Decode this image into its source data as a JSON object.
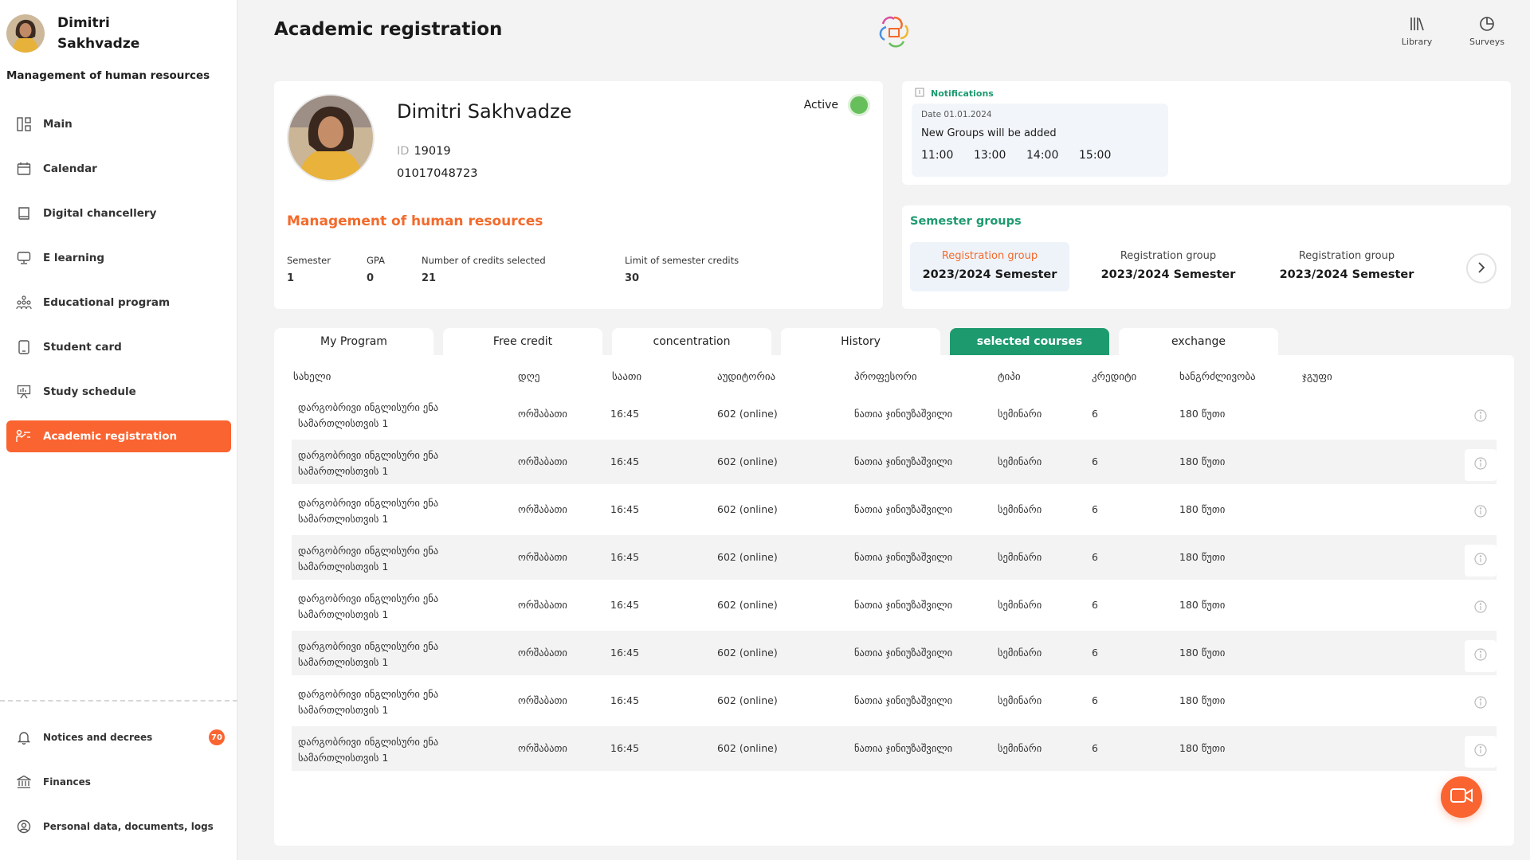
{
  "user": {
    "name": "Dimitri Sakhvadze",
    "department": "Management of human resources"
  },
  "sidebar": {
    "items": [
      {
        "label": "Main",
        "icon": "dashboard-icon"
      },
      {
        "label": "Calendar",
        "icon": "calendar-icon"
      },
      {
        "label": "Digital chancellery",
        "icon": "book-icon"
      },
      {
        "label": "E learning",
        "icon": "monitor-icon"
      },
      {
        "label": "Educational program",
        "icon": "people-icon"
      },
      {
        "label": "Student card",
        "icon": "phone-card-icon"
      },
      {
        "label": "Study schedule",
        "icon": "presentation-icon"
      },
      {
        "label": "Academic registration",
        "icon": "registration-icon",
        "active": true
      }
    ],
    "bottom_items": [
      {
        "label": "Notices and decrees",
        "icon": "bell-icon",
        "badge": "70"
      },
      {
        "label": "Finances",
        "icon": "bank-icon"
      },
      {
        "label": "Personal data, documents, logs",
        "icon": "user-circle-icon"
      }
    ]
  },
  "header": {
    "title": "Academic registration",
    "actions": [
      {
        "label": "Library",
        "icon": "library-icon"
      },
      {
        "label": "Surveys",
        "icon": "pie-chart-icon"
      }
    ]
  },
  "profile": {
    "name": "Dimitri Sakhvadze",
    "id_label": "ID",
    "id": "19019",
    "personal_number": "01017048723",
    "status": "Active",
    "program": "Management of human resources",
    "stats": [
      {
        "label": "Semester",
        "value": "1"
      },
      {
        "label": "GPA",
        "value": "0"
      },
      {
        "label": "Number of credits selected",
        "value": "21"
      },
      {
        "label": "Limit of semester credits",
        "value": "30"
      }
    ]
  },
  "notifications": {
    "title": "Notifications",
    "date": "Date 01.01.2024",
    "text": "New Groups will be added",
    "times": [
      "11:00",
      "13:00",
      "14:00",
      "15:00"
    ]
  },
  "groups": {
    "title": "Semester groups",
    "items": [
      {
        "label": "Registration group",
        "semester": "2023/2024 Semester"
      },
      {
        "label": "Registration group",
        "semester": "2023/2024 Semester"
      },
      {
        "label": "Registration group",
        "semester": "2023/2024 Semester"
      }
    ]
  },
  "tabs": [
    "My Program",
    "Free credit",
    "concentration",
    "History",
    "selected courses",
    "exchange"
  ],
  "active_tab": "selected courses",
  "table": {
    "headers": [
      "სახელი",
      "დღე",
      "საათი",
      "აუდიტორია",
      "პროფესორი",
      "ტიპი",
      "კრედიტი",
      "ხანგრძლივობა",
      "ჯგუფი"
    ],
    "rows": [
      {
        "name1": "დარგობრივი ინგლისური ენა",
        "name2": "სამართლისთვის 1",
        "day": "ორშაბათი",
        "time": "16:45",
        "room": "602 (online)",
        "professor": "ნათია ჯინიუზაშვილი",
        "type": "სემინარი",
        "credit": "6",
        "duration": "180 წუთი",
        "group": ""
      },
      {
        "name1": "დარგობრივი ინგლისური ენა",
        "name2": "სამართლისთვის 1",
        "day": "ორშაბათი",
        "time": "16:45",
        "room": "602 (online)",
        "professor": "ნათია ჯინიუზაშვილი",
        "type": "სემინარი",
        "credit": "6",
        "duration": "180 წუთი",
        "group": ""
      },
      {
        "name1": "დარგობრივი ინგლისური ენა",
        "name2": "სამართლისთვის 1",
        "day": "ორშაბათი",
        "time": "16:45",
        "room": "602 (online)",
        "professor": "ნათია ჯინიუზაშვილი",
        "type": "სემინარი",
        "credit": "6",
        "duration": "180 წუთი",
        "group": ""
      },
      {
        "name1": "დარგობრივი ინგლისური ენა",
        "name2": "სამართლისთვის 1",
        "day": "ორშაბათი",
        "time": "16:45",
        "room": "602 (online)",
        "professor": "ნათია ჯინიუზაშვილი",
        "type": "სემინარი",
        "credit": "6",
        "duration": "180 წუთი",
        "group": ""
      },
      {
        "name1": "დარგობრივი ინგლისური ენა",
        "name2": "სამართლისთვის 1",
        "day": "ორშაბათი",
        "time": "16:45",
        "room": "602 (online)",
        "professor": "ნათია ჯინიუზაშვილი",
        "type": "სემინარი",
        "credit": "6",
        "duration": "180 წუთი",
        "group": ""
      },
      {
        "name1": "დარგობრივი ინგლისური ენა",
        "name2": "სამართლისთვის 1",
        "day": "ორშაბათი",
        "time": "16:45",
        "room": "602 (online)",
        "professor": "ნათია ჯინიუზაშვილი",
        "type": "სემინარი",
        "credit": "6",
        "duration": "180 წუთი",
        "group": ""
      },
      {
        "name1": "დარგობრივი ინგლისური ენა",
        "name2": "სამართლისთვის 1",
        "day": "ორშაბათი",
        "time": "16:45",
        "room": "602 (online)",
        "professor": "ნათია ჯინიუზაშვილი",
        "type": "სემინარი",
        "credit": "6",
        "duration": "180 წუთი",
        "group": ""
      },
      {
        "name1": "დარგობრივი ინგლისური ენა",
        "name2": "სამართლისთვის 1",
        "day": "ორშაბათი",
        "time": "16:45",
        "room": "602 (online)",
        "professor": "ნათია ჯინიუზაშვილი",
        "type": "სემინარი",
        "credit": "6",
        "duration": "180 წუთი",
        "group": ""
      }
    ]
  },
  "colors": {
    "accent_orange": "#fa6431",
    "accent_green": "#1e9a6f",
    "status_green": "#67bf5c"
  }
}
